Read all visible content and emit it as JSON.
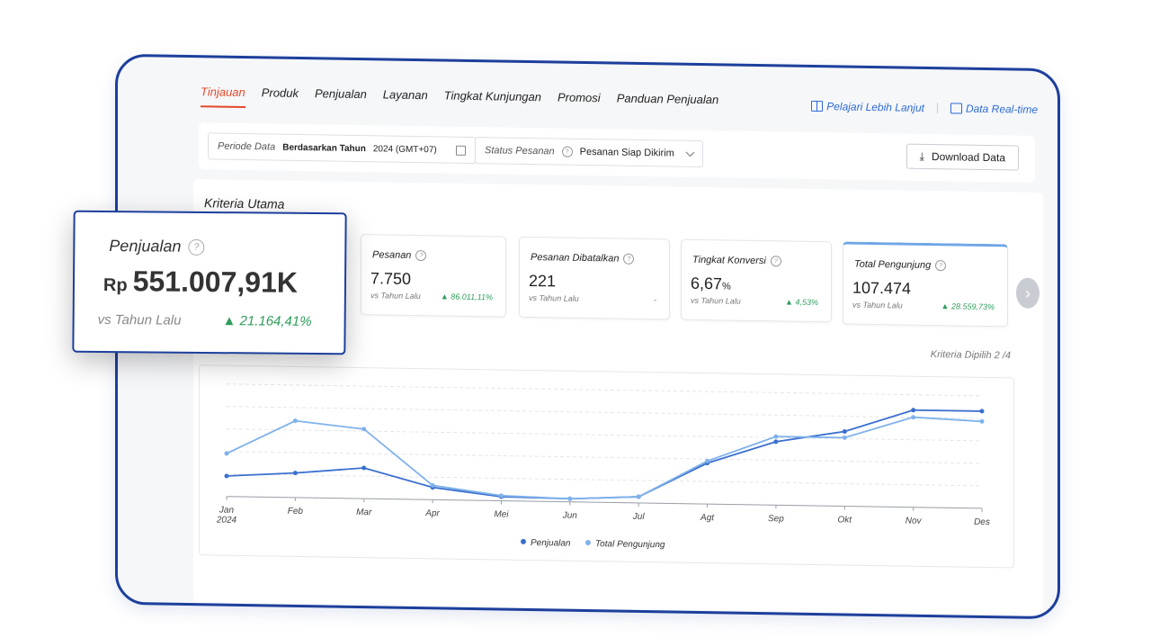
{
  "nav": {
    "tabs": [
      "Tinjauan",
      "Produk",
      "Penjualan",
      "Layanan",
      "Tingkat Kunjungan",
      "Promosi",
      "Panduan Penjualan"
    ],
    "active": "Tinjauan",
    "learn_more": "Pelajari Lebih Lanjut",
    "realtime": "Data Real-time"
  },
  "filter": {
    "period_label": "Periode Data",
    "period_value": "Berdasarkan Tahun",
    "period_year": "2024 (GMT+07)",
    "status_label": "Status Pesanan",
    "status_value": "Pesanan Siap Dikirim",
    "download": "Download Data"
  },
  "section_title": "Kriteria Utama",
  "cards": [
    {
      "title": "Pesanan",
      "value": "7.750",
      "vs": "vs Tahun Lalu",
      "change": "86.011,11%"
    },
    {
      "title": "Pesanan Dibatalkan",
      "value": "221",
      "vs": "vs Tahun Lalu",
      "change": "-"
    },
    {
      "title": "Tingkat Konversi",
      "value": "6,67",
      "unit": "%",
      "vs": "vs Tahun Lalu",
      "change": "4,53%"
    },
    {
      "title": "Total Pengunjung",
      "value": "107.474",
      "vs": "vs Tahun Lalu",
      "change": "28.559,73%"
    }
  ],
  "kriteria_dipilih": "Kriteria Dipilih 2 /4",
  "float_card": {
    "title": "Penjualan",
    "currency": "Rp",
    "value": "551.007,91K",
    "vs": "vs Tahun Lalu",
    "change": "21.164,41%"
  },
  "colors": {
    "accent": "#e4472a",
    "frame": "#1d3f9c",
    "link": "#2e6bd6",
    "up": "#2e9e5b",
    "series1": "#3a6fd0",
    "series2": "#7fb2ea"
  },
  "chart_data": {
    "type": "line",
    "categories": [
      "Jan 2024",
      "Feb",
      "Mar",
      "Apr",
      "Mei",
      "Jun",
      "Jul",
      "Agt",
      "Sep",
      "Okt",
      "Nov",
      "Des"
    ],
    "series": [
      {
        "name": "Penjualan",
        "values": [
          20,
          24,
          30,
          12,
          4,
          3,
          6,
          40,
          62,
          73,
          95,
          95
        ]
      },
      {
        "name": "Total Pengunjung",
        "values": [
          42,
          75,
          68,
          14,
          5,
          3,
          6,
          42,
          67,
          67,
          88,
          85
        ]
      }
    ],
    "ylim": [
      0,
      110
    ],
    "grid": true,
    "legend": "bottom"
  }
}
